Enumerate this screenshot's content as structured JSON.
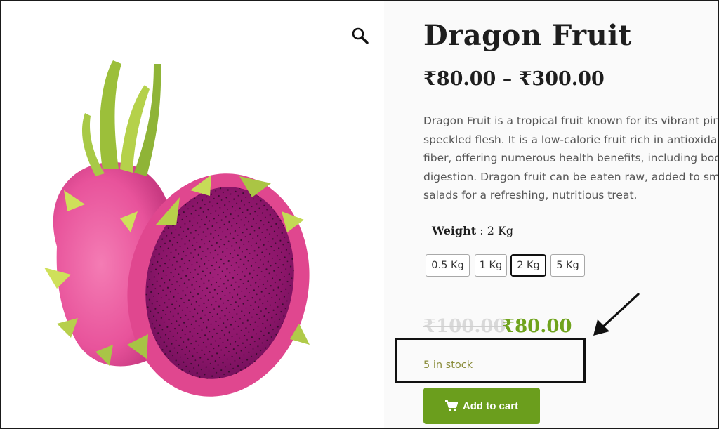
{
  "product": {
    "title": "Dragon Fruit",
    "price_range": "₹80.00 – ₹300.00",
    "description_lines": [
      "Dragon Fruit is a tropical fruit known for its vibrant pink or",
      "speckled flesh. It is a low-calorie fruit rich in antioxidants",
      "fiber, offering numerous health benefits, including boosti",
      "digestion. Dragon fruit can be eaten raw, added to smooth",
      "salads for a refreshing, nutritious treat."
    ],
    "weight_label": "Weight",
    "weight_separator": " : ",
    "weight_selected": "2 Kg",
    "weight_options": [
      "0.5 Kg",
      "1 Kg",
      "2 Kg",
      "5 Kg"
    ],
    "selected_option_index": 2,
    "regular_price": "₹100.00",
    "sale_price": "₹80.00",
    "stock_text": "5 in stock",
    "add_to_cart_label": "Add to cart"
  },
  "icons": {
    "zoom": "magnifier-icon",
    "cart": "shopping-cart-icon",
    "annotation": "arrow-annotation-icon"
  },
  "colors": {
    "accent_green": "#6b9e1d",
    "sale_price": "#6fa31c",
    "stock_text": "#8a8c3a",
    "title": "#1e1e1e"
  }
}
